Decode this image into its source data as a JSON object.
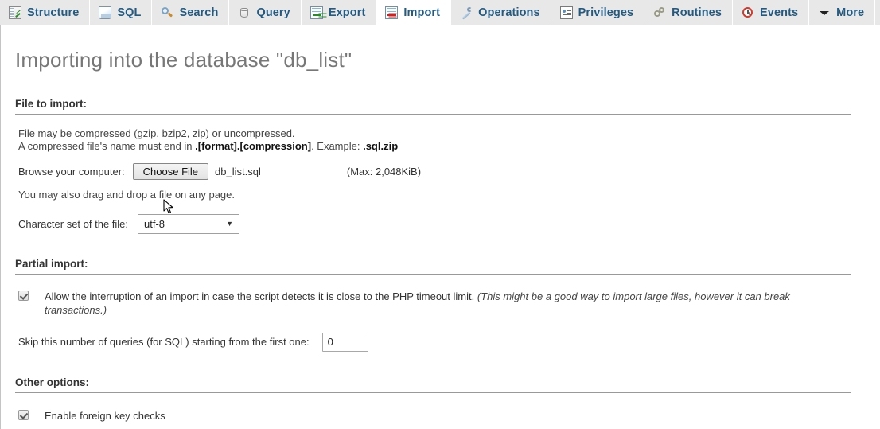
{
  "tabs": [
    {
      "label": "Structure",
      "icon": "structure-icon",
      "active": false
    },
    {
      "label": "SQL",
      "icon": "sql-icon",
      "active": false
    },
    {
      "label": "Search",
      "icon": "search-icon",
      "active": false
    },
    {
      "label": "Query",
      "icon": "query-database-icon",
      "active": false
    },
    {
      "label": "Export",
      "icon": "export-icon",
      "active": false
    },
    {
      "label": "Import",
      "icon": "import-icon",
      "active": true
    },
    {
      "label": "Operations",
      "icon": "wrench-icon",
      "active": false
    },
    {
      "label": "Privileges",
      "icon": "id-card-icon",
      "active": false
    },
    {
      "label": "Routines",
      "icon": "gears-icon",
      "active": false
    },
    {
      "label": "Events",
      "icon": "clock-icon",
      "active": false
    },
    {
      "label": "More",
      "icon": "chevron-down-icon",
      "active": false
    }
  ],
  "page": {
    "title": "Importing into the database \"db_list\""
  },
  "file_section": {
    "heading": "File to import:",
    "note_line1": "File may be compressed (gzip, bzip2, zip) or uncompressed.",
    "note_line2_prefix": "A compressed file's name must end in ",
    "note_line2_bold1": ".[format].[compression]",
    "note_line2_mid": ". Example: ",
    "note_line2_bold2": ".sql.zip",
    "browse_label": "Browse your computer:",
    "choose_button": "Choose File",
    "selected_file": "db_list.sql",
    "max_size": "(Max: 2,048KiB)",
    "dragdrop_note": "You may also drag and drop a file on any page.",
    "charset_label": "Character set of the file:",
    "charset_value": "utf-8",
    "charset_caret": "▼"
  },
  "partial_section": {
    "heading": "Partial import:",
    "allow_interrupt_text": "Allow the interruption of an import in case the script detects it is close to the PHP timeout limit. ",
    "allow_interrupt_italic": "(This might be a good way to import large files, however it can break transactions.)",
    "allow_interrupt_checked": true,
    "skip_label": "Skip this number of queries (for SQL) starting from the first one:",
    "skip_value": "0"
  },
  "other_section": {
    "heading": "Other options:",
    "foreign_key_label": "Enable foreign key checks",
    "foreign_key_checked": true
  },
  "colors": {
    "tab_link": "#235a81",
    "tab_bg": "#e8e8e8",
    "title_gray": "#777777",
    "rule": "#999999"
  }
}
